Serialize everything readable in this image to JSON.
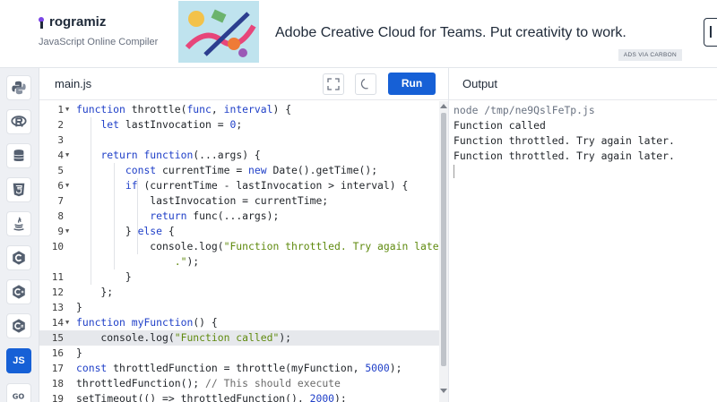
{
  "header": {
    "logo_text": "rogramiz",
    "logo_initial": "P",
    "subtitle": "JavaScript Online Compiler",
    "ad_text": "Adobe Creative Cloud for Teams. Put creativity to work.",
    "ad_via": "ADS VIA CARBON"
  },
  "sidebar": {
    "items": [
      {
        "name": "python",
        "icon": "python-icon"
      },
      {
        "name": "r",
        "icon": "r-icon"
      },
      {
        "name": "sql",
        "icon": "database-icon"
      },
      {
        "name": "html",
        "icon": "html5-icon"
      },
      {
        "name": "java",
        "icon": "java-icon"
      },
      {
        "name": "c",
        "icon": "c-icon"
      },
      {
        "name": "cpp",
        "icon": "cpp-icon"
      },
      {
        "name": "csharp",
        "icon": "csharp-icon"
      },
      {
        "name": "js",
        "label": "JS",
        "active": true
      },
      {
        "name": "go",
        "icon": "go-icon"
      }
    ]
  },
  "editor": {
    "tab": "main.js",
    "run_label": "Run",
    "highlight_line": 15,
    "lines": [
      {
        "n": "1",
        "fold": true,
        "html": "<span class='kw'>function</span> throttle(<span class='kw'>func</span>, <span class='kw'>interval</span>) {"
      },
      {
        "n": "2",
        "html": "    <span class='kw'>let</span> lastInvocation = <span class='num'>0</span>;"
      },
      {
        "n": "3",
        "html": ""
      },
      {
        "n": "4",
        "fold": true,
        "html": "    <span class='kw'>return</span> <span class='kw'>function</span>(...args) {"
      },
      {
        "n": "5",
        "html": "        <span class='kw'>const</span> currentTime = <span class='kw'>new</span> Date().getTime();"
      },
      {
        "n": "6",
        "fold": true,
        "html": "        <span class='kw'>if</span> (currentTime - lastInvocation &gt; interval) {"
      },
      {
        "n": "7",
        "html": "            lastInvocation = currentTime;"
      },
      {
        "n": "8",
        "html": "            <span class='kw'>return</span> func(...args);"
      },
      {
        "n": "9",
        "fold": true,
        "html": "        } <span class='kw'>else</span> {"
      },
      {
        "n": "10",
        "html": "            console.log(<span class='str'>\"Function throttled. Try again later</span>"
      },
      {
        "n": "",
        "html": "                <span class='str'>.\"</span>);"
      },
      {
        "n": "11",
        "html": "        }"
      },
      {
        "n": "12",
        "html": "    };"
      },
      {
        "n": "13",
        "html": "}"
      },
      {
        "n": "14",
        "fold": true,
        "html": "<span class='kw'>function</span> <span class='kw'>myFunction</span>() {"
      },
      {
        "n": "15",
        "html": "    console.log(<span class='str'>\"Function called\"</span>);"
      },
      {
        "n": "16",
        "html": "}"
      },
      {
        "n": "17",
        "html": "<span class='kw'>const</span> throttledFunction = throttle(myFunction, <span class='num'>5000</span>);"
      },
      {
        "n": "18",
        "html": "throttledFunction(); <span class='cm'>// This should execute</span>"
      },
      {
        "n": "19",
        "html": "setTimeout(() =&gt; throttledFunction(), <span class='num'>2000</span>);"
      }
    ]
  },
  "output": {
    "title": "Output",
    "lines": [
      "node /tmp/ne9QslFeTp.js",
      "Function called",
      "Function throttled. Try again later.",
      "Function throttled. Try again later."
    ]
  }
}
